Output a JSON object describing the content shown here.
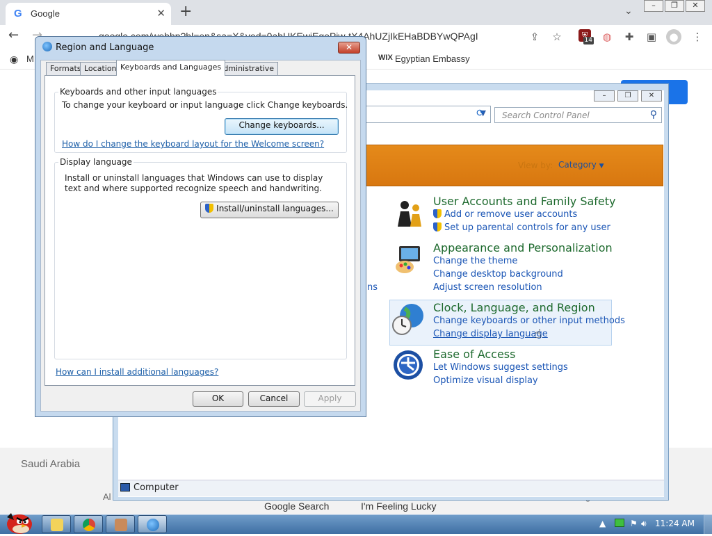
{
  "browser": {
    "tab_title": "Google",
    "url": "google.com/webhp?hl=en&sa=X&ved=0ahUKEwiEgoPiw-tX4AhUZjIkEHaBDBYwQPAgI",
    "extension_badge": "14",
    "bookmarks": [
      "M",
      "Egyptian Embassy"
    ]
  },
  "google": {
    "country": "Saudi Arabia",
    "search_button": "Google Search",
    "lucky_button": "I'm Feeling Lucky",
    "footer_left_fragment": "Al",
    "footer_right_fragment": "g"
  },
  "control_panel": {
    "search_placeholder": "Search Control Panel",
    "view_by_label": "View by:",
    "view_by_value": "Category",
    "truncated_link": "ns",
    "status_text": "Computer",
    "categories": [
      {
        "title": "User Accounts and Family Safety",
        "links": [
          "Add or remove user accounts",
          "Set up parental controls for any user"
        ]
      },
      {
        "title": "Appearance and Personalization",
        "links": [
          "Change the theme",
          "Change desktop background",
          "Adjust screen resolution"
        ]
      },
      {
        "title": "Clock, Language, and Region",
        "links": [
          "Change keyboards or other input methods",
          "Change display language"
        ]
      },
      {
        "title": "Ease of Access",
        "links": [
          "Let Windows suggest settings",
          "Optimize visual display"
        ]
      }
    ]
  },
  "dialog": {
    "title": "Region and Language",
    "tabs": [
      "Formats",
      "Location",
      "Keyboards and Languages",
      "Administrative"
    ],
    "keyboards_group": {
      "label": "Keyboards and other input languages",
      "text": "To change your keyboard or input language click Change keyboards.",
      "button": "Change keyboards...",
      "link": "How do I change the keyboard layout for the Welcome screen?"
    },
    "display_group": {
      "label": "Display language",
      "text": "Install or uninstall languages that Windows can use to display text and where supported recognize speech and handwriting.",
      "button": "Install/uninstall languages..."
    },
    "bottom_link": "How can I install additional languages?",
    "ok": "OK",
    "cancel": "Cancel",
    "apply": "Apply"
  },
  "taskbar": {
    "time": "11:24 AM"
  }
}
